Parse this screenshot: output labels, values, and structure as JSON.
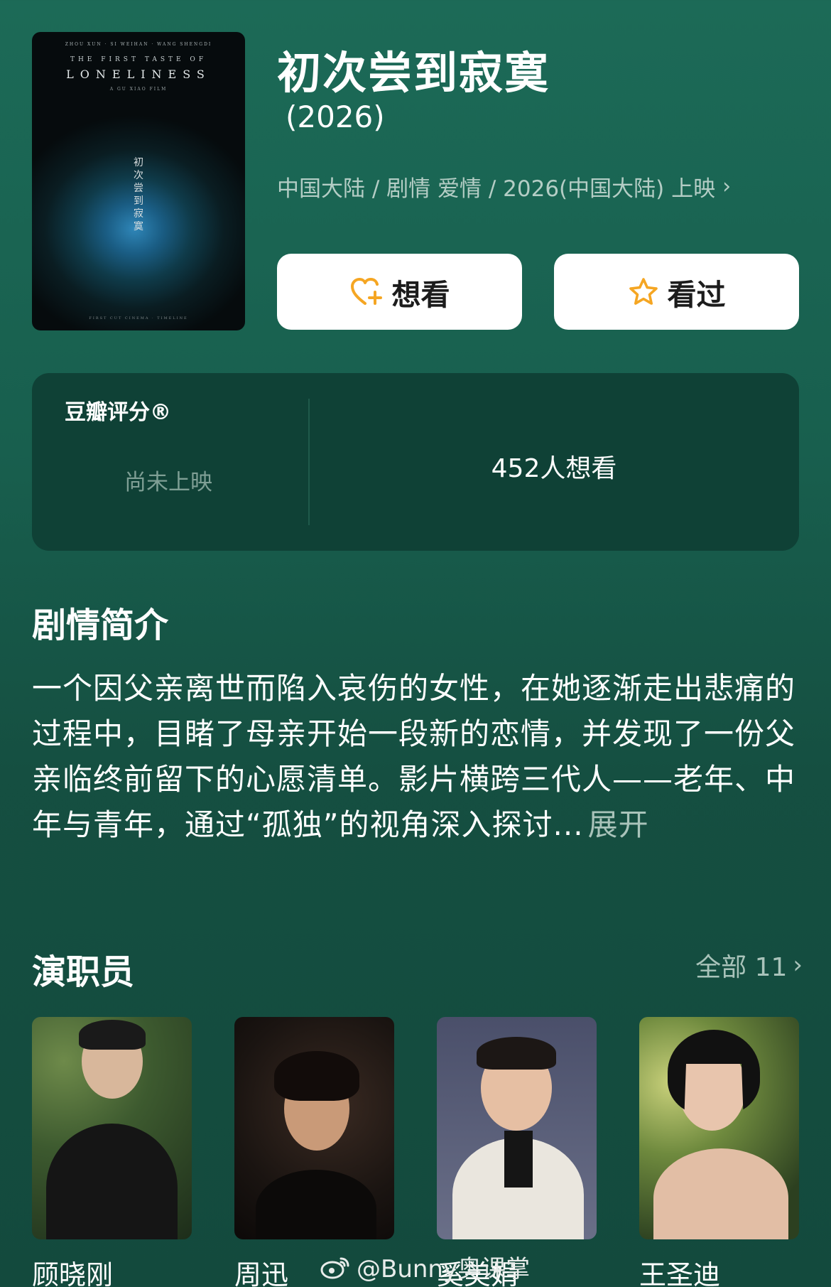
{
  "poster": {
    "top_small": "ZHOU XUN · SI WEIHAN · WANG SHENGDI",
    "en_line1": "THE FIRST TASTE OF",
    "en_line2": "LONELINESS",
    "director_line": "A GU XIAO FILM",
    "cn_vertical": "初次尝到寂寞",
    "bottom_small": "FIRST CUT CINEMA · TIMELINE"
  },
  "movie": {
    "title": "初次尝到寂寞",
    "year": "(2026)",
    "meta": "中国大陆 / 剧情 爱情 / 2026(中国大陆) 上映"
  },
  "actions": {
    "want_label": "想看",
    "seen_label": "看过"
  },
  "rating": {
    "label": "豆瓣评分®",
    "status": "尚未上映",
    "want_count": "452人想看"
  },
  "synopsis": {
    "heading": "剧情简介",
    "text": "一个因父亲离世而陷入哀伤的女性，在她逐渐走出悲痛的过程中，目睹了母亲开始一段新的恋情，并发现了一份父亲临终前留下的心愿清单。影片横跨三代人——老年、中年与青年，通过“孤独”的视角深入探讨...",
    "expand_label": "展开"
  },
  "cast": {
    "heading": "演职员",
    "all_label": "全部 11",
    "members": [
      {
        "name": "顾晓刚"
      },
      {
        "name": "周迅"
      },
      {
        "name": "奚美娟"
      },
      {
        "name": "王圣迪"
      }
    ]
  },
  "watermark": "@Bunny奥课掌",
  "colors": {
    "background": "#185f4e",
    "card": "#0f4136",
    "button": "#ffffff",
    "accent_icon": "#f5a623",
    "muted_text": "#b4cdc5"
  }
}
